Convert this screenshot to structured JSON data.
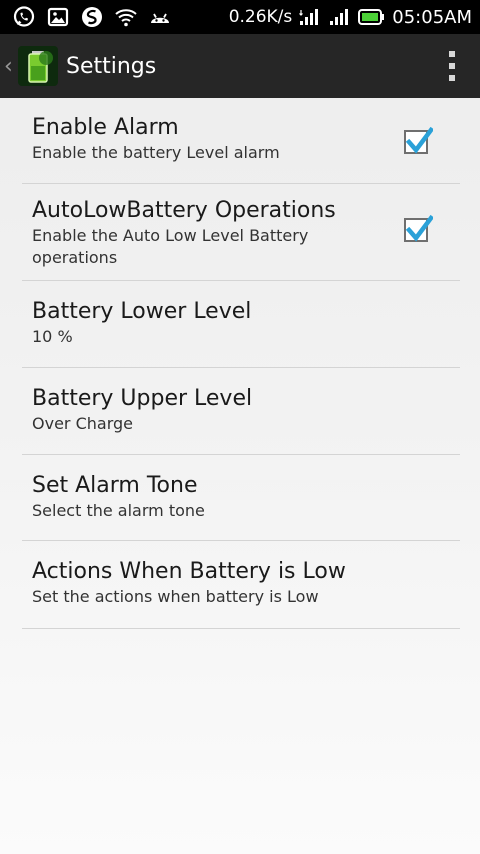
{
  "status_bar": {
    "speed": "0.26K/s",
    "time": "05:05AM",
    "icons": [
      "whatsapp-icon",
      "image-icon",
      "sync-icon",
      "wifi-icon",
      "android-icon",
      "signal-icon",
      "signal-icon",
      "battery-icon"
    ]
  },
  "action_bar": {
    "title": "Settings"
  },
  "settings": [
    {
      "title": "Enable Alarm",
      "summary": "Enable the battery Level alarm",
      "checked": true
    },
    {
      "title": "AutoLowBattery Operations",
      "summary": "Enable the Auto Low Level Battery operations",
      "checked": true
    },
    {
      "title": "Battery Lower Level",
      "summary": "10 %"
    },
    {
      "title": "Battery Upper Level",
      "summary": "Over Charge"
    },
    {
      "title": "Set Alarm Tone",
      "summary": "Select the alarm tone"
    },
    {
      "title": "Actions When Battery is Low",
      "summary": "Set the actions when battery is Low"
    }
  ],
  "colors": {
    "checkmark": "#2aa1d8",
    "action_bar": "#262626",
    "status_bar": "#000000",
    "battery_fill": "#4cd137"
  }
}
